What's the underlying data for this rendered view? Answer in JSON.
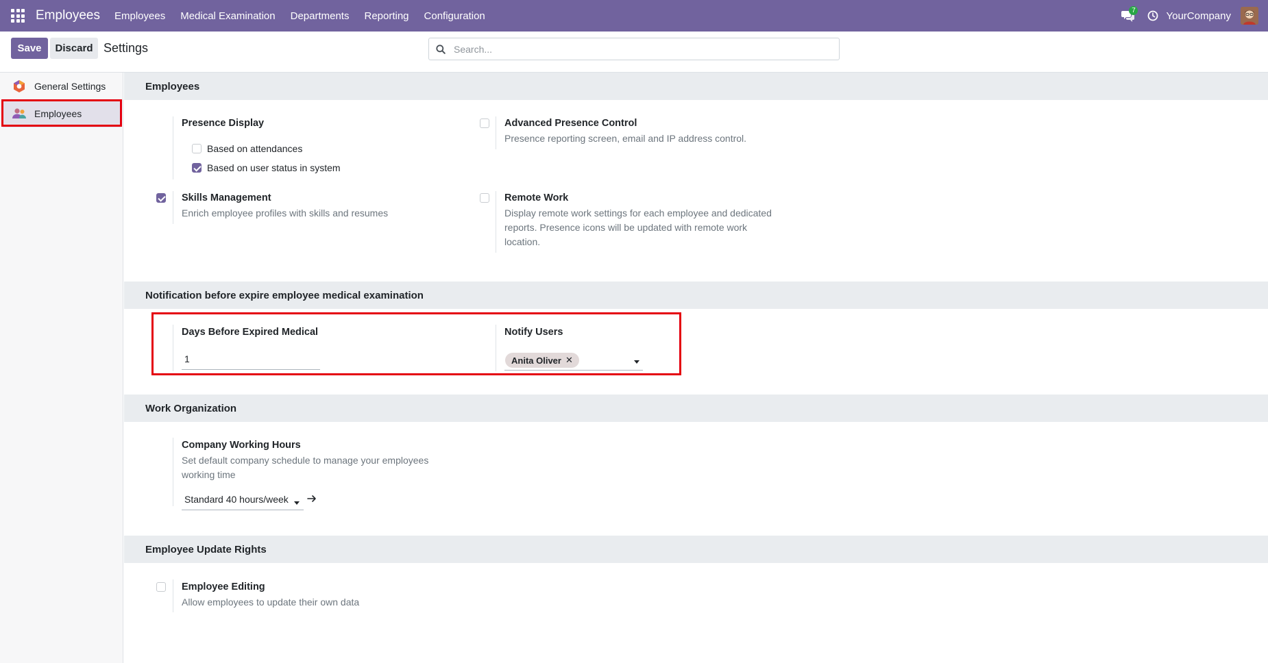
{
  "navbar": {
    "app_name": "Employees",
    "menu": [
      "Employees",
      "Medical Examination",
      "Departments",
      "Reporting",
      "Configuration"
    ],
    "chat_count": "7",
    "company": "YourCompany",
    "colors": {
      "bar": "#71639e",
      "badge": "#28a745"
    }
  },
  "control_panel": {
    "save_label": "Save",
    "discard_label": "Discard",
    "title": "Settings",
    "search_placeholder": "Search..."
  },
  "sidebar": {
    "items": [
      {
        "label": "General Settings",
        "icon": "odoo-logo-icon"
      },
      {
        "label": "Employees",
        "icon": "employees-icon",
        "active": true
      }
    ]
  },
  "sections": {
    "employees": {
      "title": "Employees",
      "presence_display": {
        "title": "Presence Display",
        "options": [
          {
            "label": "Based on attendances",
            "checked": false
          },
          {
            "label": "Based on user status in system",
            "checked": true
          }
        ]
      },
      "advanced_presence": {
        "title": "Advanced Presence Control",
        "desc": "Presence reporting screen, email and IP address control.",
        "checked": false
      },
      "skills": {
        "title": "Skills Management",
        "desc": "Enrich employee profiles with skills and resumes",
        "checked": true
      },
      "remote_work": {
        "title": "Remote Work",
        "desc_lines": [
          "Display remote work settings for each employee and dedicated",
          "reports. Presence icons will be updated with remote work",
          "location."
        ],
        "checked": false
      }
    },
    "notification": {
      "title": "Notification before expire employee medical examination",
      "days_label": "Days Before Expired Medical",
      "days_value": "1",
      "notify_label": "Notify Users",
      "notify_tags": [
        "Anita Oliver"
      ]
    },
    "work_org": {
      "title": "Work Organization",
      "hours_title": "Company Working Hours",
      "hours_desc_lines": [
        "Set default company schedule to manage your employees",
        "working time"
      ],
      "hours_value": "Standard 40 hours/week"
    },
    "update_rights": {
      "title": "Employee Update Rights",
      "editing_title": "Employee Editing",
      "editing_desc": "Allow employees to update their own data",
      "checked": false
    }
  }
}
